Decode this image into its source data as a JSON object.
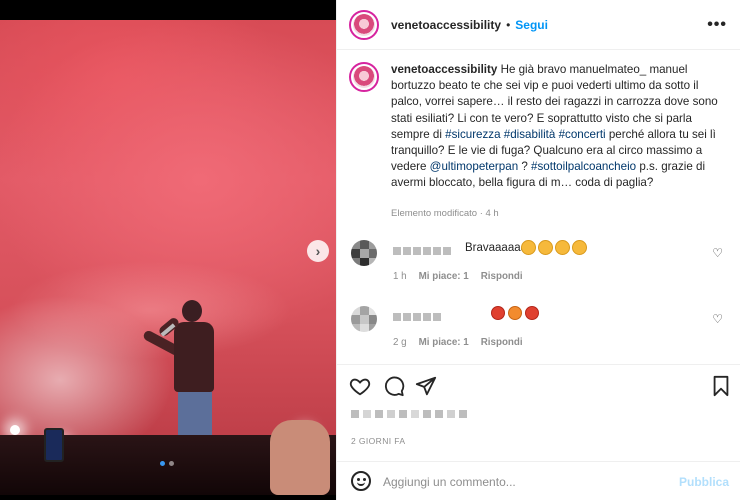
{
  "post": {
    "username": "venetoaccessibility",
    "separator": "•",
    "follow_label": "Segui",
    "more_icon": "more-horizontal-icon"
  },
  "caption": {
    "username": "venetoaccessibility",
    "text_1": " He già bravo manuelmateo_ manuel bortuzzo beato te che sei vip e puoi vederti ultimo da sotto il palco, vorrei sapere… il resto dei ragazzi in carrozza dove sono stati esiliati? Li con te vero? E soprattutto visto che si parla sempre di ",
    "tag_1": "#sicurezza",
    "tag_2": "#disabilità",
    "tag_3": "#concerti",
    "text_2": " perché allora tu sei lì tranquillo? E le vie di fuga? Qualcuno era al circo massimo a vedere ",
    "mention": "@ultimopeterpan",
    "text_3": " ? ",
    "tag_4": "#sottoilpalcoancheio",
    "text_4": " p.s. grazie di avermi bloccato, bella figura di m… coda di paglia?",
    "meta": "Elemento modificato · 4 h"
  },
  "comments": [
    {
      "text": "Bravaaaaaa",
      "time": "1 h",
      "likes": "Mi piace: 1",
      "reply": "Rispondi"
    },
    {
      "text": "",
      "time": "2 g",
      "likes": "Mi piace: 1",
      "reply": "Rispondi"
    }
  ],
  "footer": {
    "date": "2 GIORNI FA",
    "comment_placeholder": "Aggiungi un commento...",
    "publish_label": "Pubblica"
  },
  "colors": {
    "accent": "#0095f6",
    "hashtag": "#00376b",
    "muted": "#8e8e8e"
  },
  "carousel": {
    "active_slide": 1,
    "total_slides": 2
  }
}
